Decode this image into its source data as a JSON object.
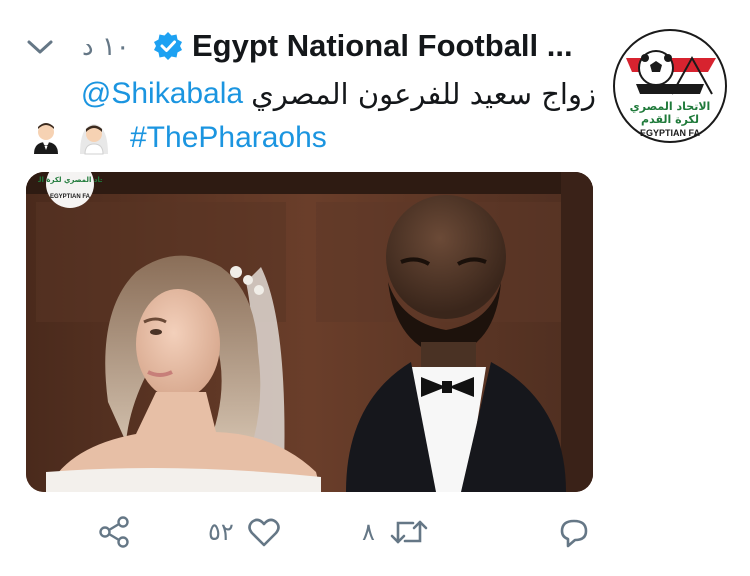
{
  "tweet": {
    "display_name": "Egypt National Football ...",
    "time": "١٠ د",
    "text_arabic": "زواج سعيد للفرعون المصري",
    "mention": "@Shikabala",
    "hashtag": "#ThePharaohs",
    "emojis": [
      "man-in-tuxedo-emoji",
      "bride-with-veil-emoji"
    ]
  },
  "avatar": {
    "logo_text_ar": "الاتحاد المصري لكرة القدم",
    "logo_text_en": "EGYPTIAN FA"
  },
  "media": {
    "watermark_text_ar": "الاتحاد المصري لكرة القدم",
    "watermark_text_en": "EGYPTIAN FA"
  },
  "actions": {
    "likes": "٥٢",
    "retweets": "٨"
  },
  "colors": {
    "link": "#1b95e0",
    "text": "#14171a",
    "muted": "#657786",
    "verified": "#1da1f2",
    "brand_red": "#d7232f",
    "brand_green": "#1f7a3a"
  }
}
